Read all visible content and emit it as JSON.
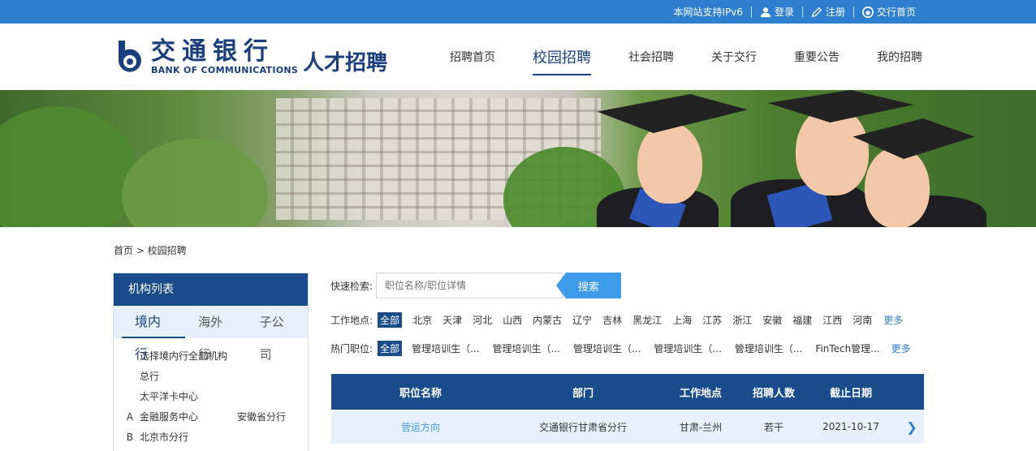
{
  "topbar": {
    "ipv6": "本网站支持IPv6",
    "login": "登录",
    "register": "注册",
    "home": "交行首页"
  },
  "header": {
    "logo_cn": "交通银行",
    "logo_en": "BANK OF COMMUNICATIONS",
    "logo_sub": "人才招聘",
    "nav": [
      "招聘首页",
      "校园招聘",
      "社会招聘",
      "关于交行",
      "重要公告",
      "我的招聘"
    ]
  },
  "breadcrumb": "首页 > 校园招聘",
  "sidebar": {
    "title": "机构列表",
    "tabs": [
      "境内行",
      "海外行",
      "子公司"
    ],
    "items": [
      {
        "letter": "",
        "a": "选择境内行全部机构",
        "b": ""
      },
      {
        "letter": "",
        "a": "总行",
        "b": ""
      },
      {
        "letter": "",
        "a": "太平洋卡中心",
        "b": ""
      },
      {
        "letter": "A",
        "a": "金融服务中心",
        "b": "安徽省分行"
      },
      {
        "letter": "B",
        "a": "北京市分行",
        "b": ""
      }
    ]
  },
  "search": {
    "label": "快速检索:",
    "placeholder": "职位名称/职位详情",
    "button": "搜索"
  },
  "filters": {
    "location": {
      "label": "工作地点:",
      "options": [
        "全部",
        "北京",
        "天津",
        "河北",
        "山西",
        "内蒙古",
        "辽宁",
        "吉林",
        "黑龙江",
        "上海",
        "江苏",
        "浙江",
        "安徽",
        "福建",
        "江西",
        "河南"
      ],
      "more": "更多"
    },
    "hot": {
      "label": "热门职位:",
      "options": [
        "全部",
        "管理培训生（...",
        "管理培训生（...",
        "管理培训生（...",
        "管理培训生（...",
        "管理培训生（...",
        "FinTech管理..."
      ],
      "more": "更多"
    }
  },
  "table": {
    "headers": [
      "职位名称",
      "部门",
      "工作地点",
      "招聘人数",
      "截止日期"
    ],
    "rows": [
      {
        "name": "营运方向",
        "dept": "交通银行甘肃省分行",
        "loc": "甘肃-兰州",
        "num": "若干",
        "date": "2021-10-17"
      }
    ]
  },
  "colors": {
    "primary": "#1a4c8b",
    "topbar": "#2f7fd1",
    "accent": "#3d9be9"
  }
}
